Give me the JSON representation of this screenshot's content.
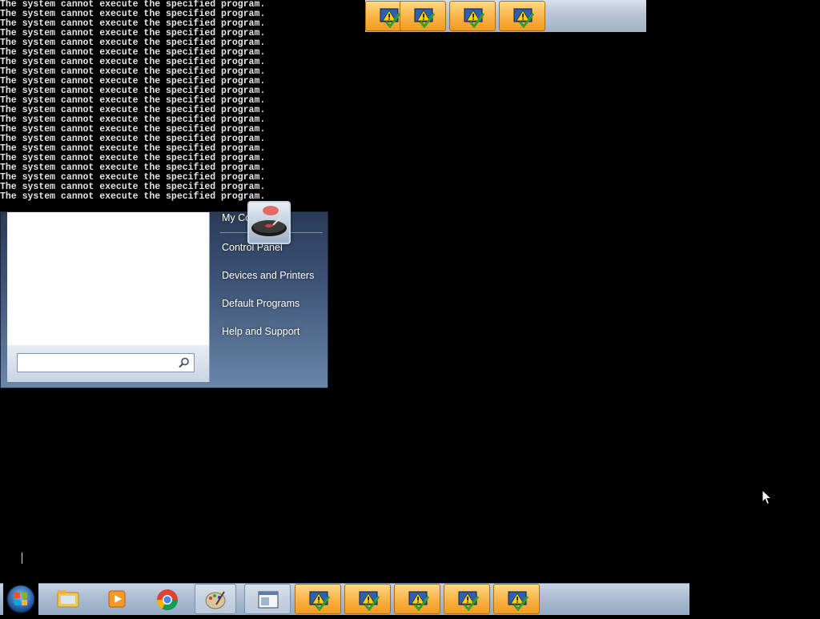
{
  "console": {
    "lines": [
      "The system cannot execute the specified program.",
      "The system cannot execute the specified program.",
      "The system cannot execute the specified program.",
      "The system cannot execute the specified program.",
      "The system cannot execute the specified program.",
      "The system cannot execute the specified program.",
      "The system cannot execute the specified program.",
      "The system cannot execute the specified program.",
      "The system cannot execute the specified program.",
      "The system cannot execute the specified program.",
      "The system cannot execute the specified program.",
      "The system cannot execute the specified program.",
      "The system cannot execute the specified program.",
      "The system cannot execute the specified program.",
      "The system cannot execute the specified program.",
      "The system cannot execute the specified program.",
      "The system cannot execute the specified program.",
      "The system cannot execute the specified program.",
      "The system cannot execute the specified program.",
      "The system cannot execute the specified program.",
      "The system cannot execute the specified program."
    ]
  },
  "start_menu": {
    "right_items": [
      {
        "label": "My Co"
      },
      {
        "label": "Control Panel"
      },
      {
        "label": "Devices and Printers"
      },
      {
        "label": "Default Programs"
      },
      {
        "label": "Help and Support"
      }
    ],
    "search_icon": "magnifier-icon",
    "avatar_icon": "user-avatar-turntable-icon"
  },
  "taskbar": {
    "start_icon": "windows-orb-icon",
    "pinned": [
      {
        "name": "explorer",
        "icon": "folder-icon"
      },
      {
        "name": "media-player",
        "icon": "media-player-icon"
      },
      {
        "name": "chrome",
        "icon": "chrome-icon"
      },
      {
        "name": "paint",
        "icon": "paint-palette-icon"
      },
      {
        "name": "window",
        "icon": "window-app-icon"
      }
    ],
    "warning_buttons_count": 5,
    "warning_icon": "warning-check-icon"
  },
  "top_strip": {
    "warning_buttons_count": 4
  },
  "colors": {
    "background": "#000000",
    "console_text": "#e6e6e6",
    "taskbar": "#a8bad0",
    "warning_button": "#f9b144"
  }
}
